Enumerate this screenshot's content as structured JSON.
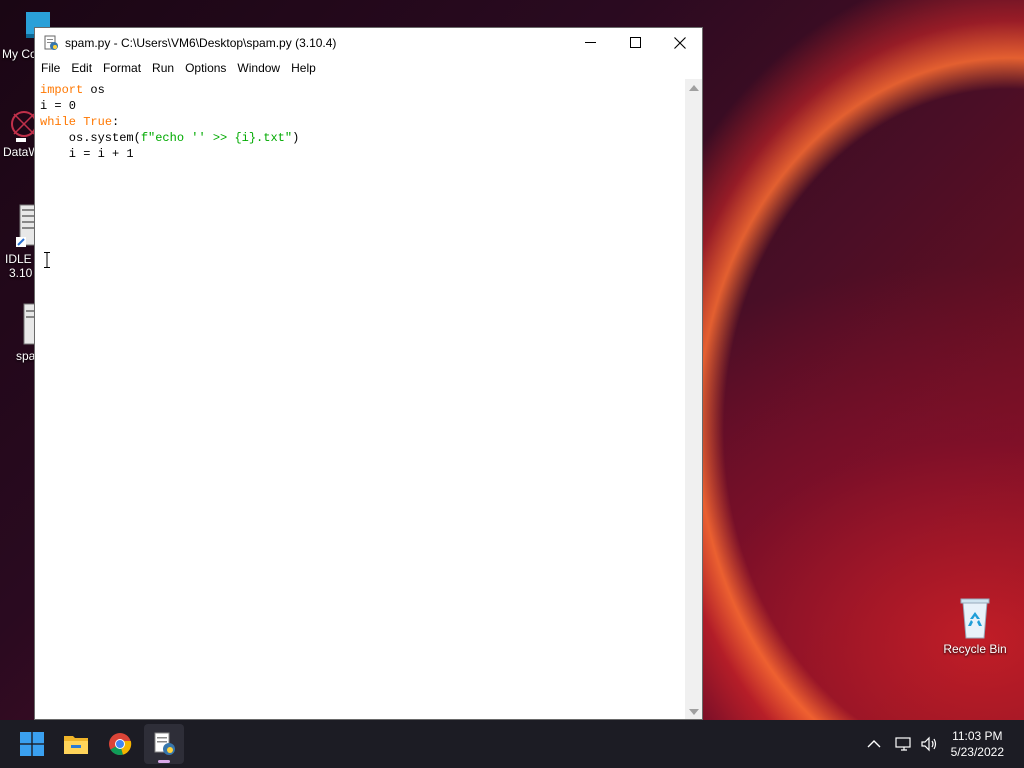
{
  "window": {
    "title": "spam.py - C:\\Users\\VM6\\Desktop\\spam.py (3.10.4)",
    "minimize_glyph": "—",
    "close_glyph": "✕"
  },
  "menu": [
    "File",
    "Edit",
    "Format",
    "Run",
    "Options",
    "Window",
    "Help"
  ],
  "code": {
    "line1_kw": "import",
    "line1_rest": " os",
    "line2": "i = 0",
    "line3_kw": "while",
    "line3_sp": " ",
    "line3_kw2": "True",
    "line3_rest": ":",
    "line4_pre": "    os.system(",
    "line4_str": "f\"echo '' >> {i}.txt\"",
    "line4_post": ")",
    "line5": "    i = i + 1"
  },
  "desktop": {
    "icons": [
      "My Co",
      "DataW",
      "IDLE (",
      "3.10",
      "spa",
      "Recycle Bin"
    ]
  },
  "taskbar": {
    "icons": [
      "windows-start-icon",
      "file-explorer-icon",
      "chrome-icon",
      "idle-python-icon"
    ]
  },
  "tray": {
    "time": "11:03 PM",
    "date": "5/23/2022"
  },
  "colors": {
    "keyword": "#ff7700",
    "string": "#00aa00",
    "taskbar": "#1c1c24"
  }
}
